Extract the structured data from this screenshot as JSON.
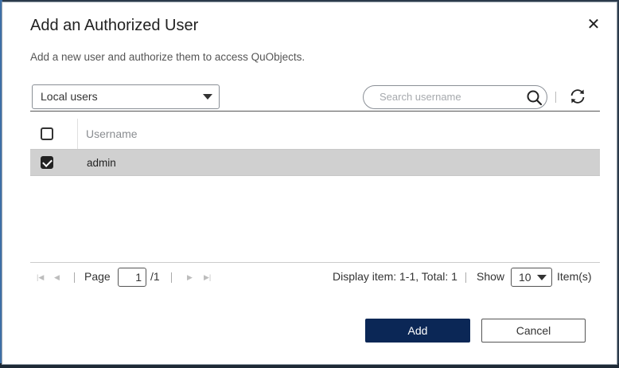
{
  "dialog": {
    "title": "Add an Authorized User",
    "subtitle": "Add a new user and authorize them to access QuObjects.",
    "close_glyph": "✕"
  },
  "filter": {
    "user_type": "Local users",
    "search_placeholder": "Search username"
  },
  "icons": {
    "close": "close-icon",
    "dropdown": "chevron-down-icon",
    "search": "search-icon",
    "refresh": "refresh-icon"
  },
  "table": {
    "columns": [
      "Username"
    ],
    "rows": [
      {
        "username": "admin",
        "checked": true
      }
    ],
    "header_checked": false
  },
  "pagination": {
    "page_label": "Page",
    "current_page": "1",
    "total_pages": "/1",
    "display_info": "Display item: 1-1, Total: 1",
    "show_label": "Show",
    "page_size": "10",
    "items_label": "Item(s)"
  },
  "buttons": {
    "add": "Add",
    "cancel": "Cancel"
  },
  "colors": {
    "primary": "#0b2756",
    "selected_row": "#d0d0d0"
  }
}
